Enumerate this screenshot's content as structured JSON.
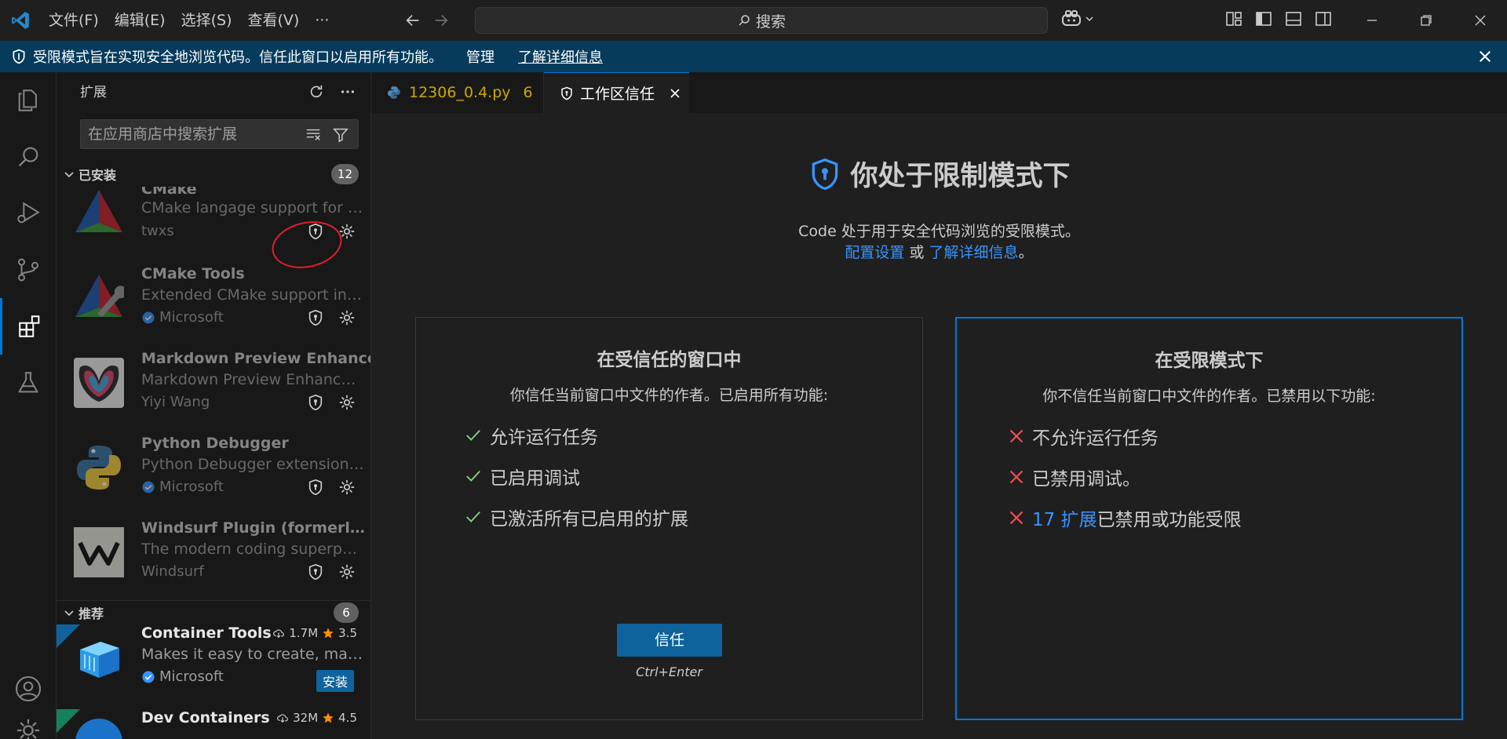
{
  "menu": [
    "文件(F)",
    "编辑(E)",
    "选择(S)",
    "查看(V)",
    "···"
  ],
  "search": {
    "label": "搜索"
  },
  "banner": {
    "message": "受限模式旨在实现安全地浏览代码。信任此窗口以启用所有功能。",
    "manage": "管理",
    "learn_more": "了解详细信息"
  },
  "sidebar": {
    "title": "扩展",
    "search_placeholder": "在应用商店中搜索扩展",
    "installed": {
      "label": "已安装",
      "count": "12"
    },
    "recommended": {
      "label": "推荐",
      "count": "6"
    },
    "installed_items": [
      {
        "name": "CMake",
        "desc": "CMake langage support for Visual Studio Code",
        "publisher": "twxs",
        "verified": false,
        "icon": "cmake-icon"
      },
      {
        "name": "CMake Tools",
        "desc": "Extended CMake support in Visual Studio Code",
        "publisher": "Microsoft",
        "verified": true,
        "icon": "cmake-tools-icon"
      },
      {
        "name": "Markdown Preview Enhanced",
        "desc": "Markdown Preview Enhanced ported to vscode",
        "publisher": "Yiyi Wang",
        "verified": false,
        "icon": "markdown-preview-icon"
      },
      {
        "name": "Python Debugger",
        "desc": "Python Debugger extension using debugpy",
        "publisher": "Microsoft",
        "verified": true,
        "icon": "python-icon"
      },
      {
        "name": "Windsurf Plugin (formerly Codeium)",
        "desc": "The modern coding superpower",
        "publisher": "Windsurf",
        "verified": false,
        "icon": "windsurf-icon"
      }
    ],
    "recommended_items": [
      {
        "name": "Container Tools",
        "desc": "Makes it easy to create, manage, and debug containerized applications.",
        "publisher": "Microsoft",
        "verified": true,
        "downloads": "1.7M",
        "rating": "3.5",
        "action": "安装"
      },
      {
        "name": "Dev Containers",
        "downloads": "32M",
        "rating": "4.5"
      }
    ]
  },
  "tabs": [
    {
      "label": "12306_0.4.py",
      "problems": "6"
    },
    {
      "label": "工作区信任"
    }
  ],
  "trust_page": {
    "title": "你处于限制模式下",
    "subtitle": "Code 处于用于安全代码浏览的受限模式。",
    "config_link": "配置设置",
    "or": " 或 ",
    "learn_link": "了解详细信息",
    "period": "。",
    "trusted": {
      "heading": "在受信任的窗口中",
      "sub": "你信任当前窗口中文件的作者。已启用所有功能:",
      "items": [
        "允许运行任务",
        "已启用调试",
        "已激活所有已启用的扩展"
      ],
      "button": "信任",
      "shortcut": "Ctrl+Enter"
    },
    "restricted": {
      "heading": "在受限模式下",
      "sub": "你不信任当前窗口中文件的作者。已禁用以下功能:",
      "items": [
        "不允许运行任务",
        "已禁用调试。"
      ],
      "ext_link": "17 扩展",
      "ext_rest": "已禁用或功能受限"
    }
  },
  "colors": {
    "accent": "#0078d4",
    "banner": "#063b5c",
    "link": "#3794ff",
    "warning": "#cca700",
    "check": "#89d185",
    "cross": "#f14c4c"
  }
}
